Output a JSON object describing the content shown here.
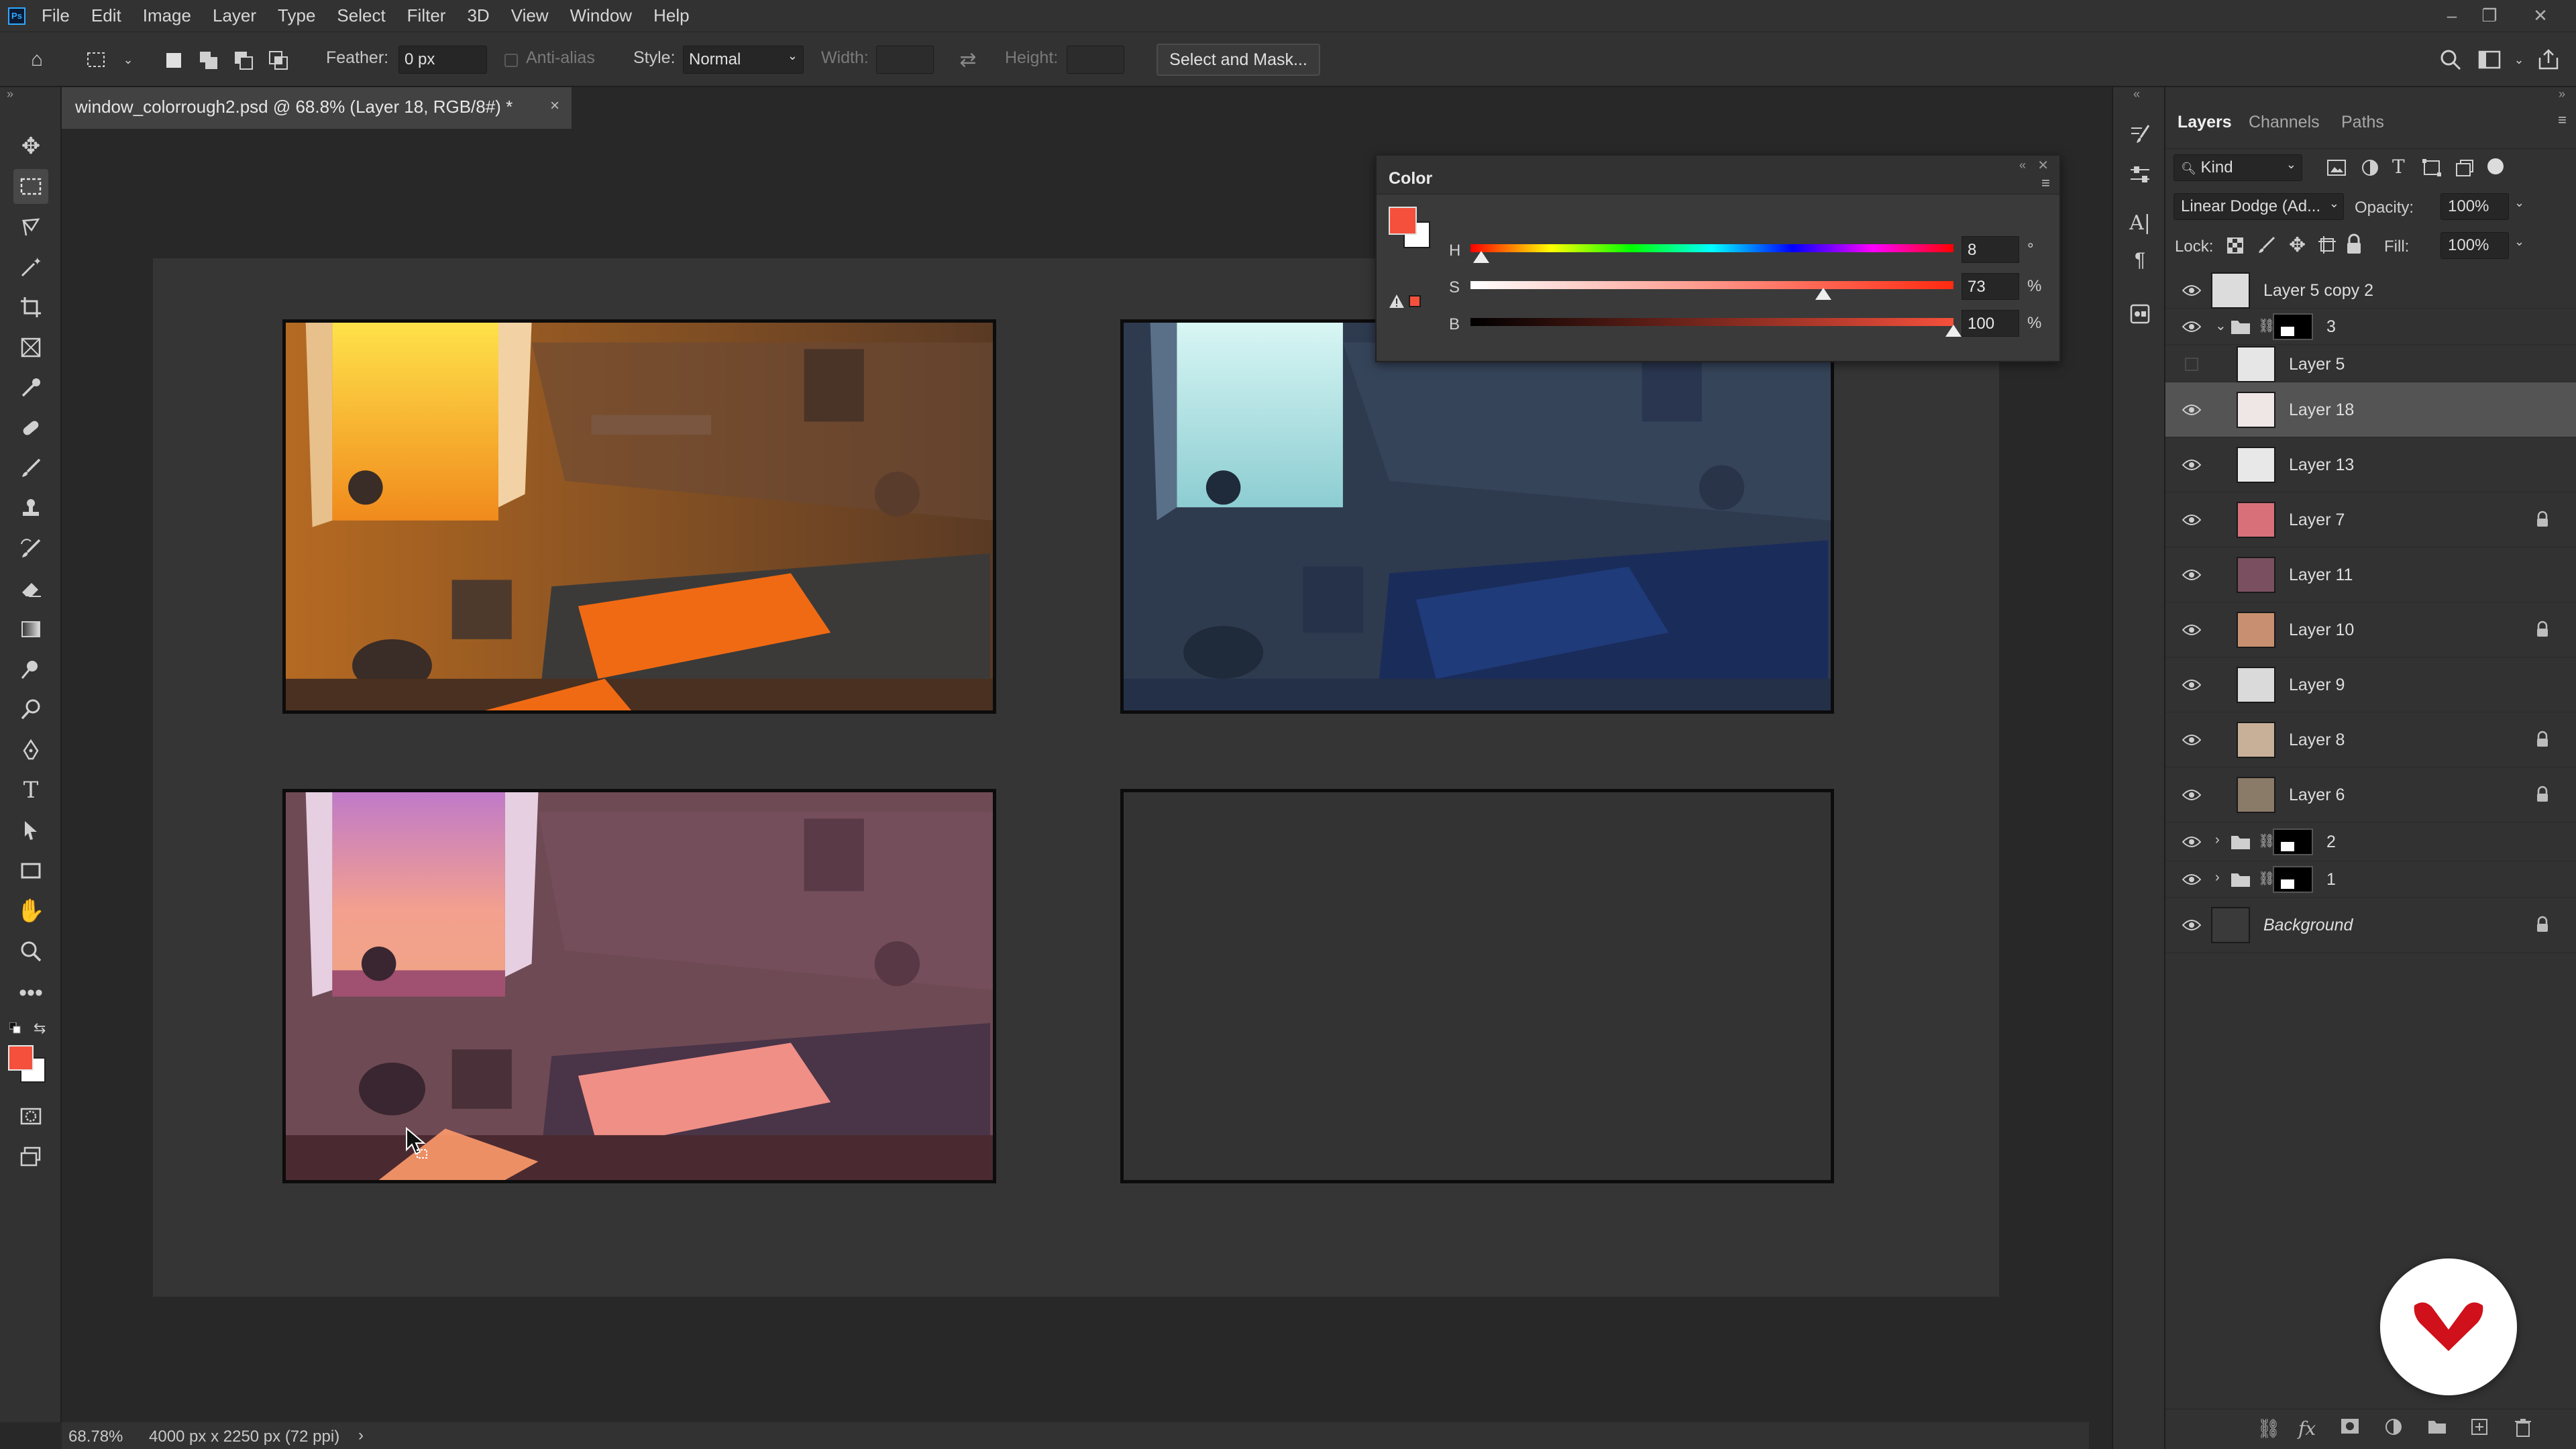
{
  "app": {
    "menu": [
      "File",
      "Edit",
      "Image",
      "Layer",
      "Type",
      "Select",
      "Filter",
      "3D",
      "View",
      "Window",
      "Help"
    ],
    "logo_text": "Ps"
  },
  "options": {
    "feather_label": "Feather:",
    "feather_value": "0 px",
    "anti_alias_label": "Anti-alias",
    "style_label": "Style:",
    "style_value": "Normal",
    "width_label": "Width:",
    "height_label": "Height:",
    "select_mask_label": "Select and Mask..."
  },
  "document": {
    "tab_title": "window_colorrough2.psd @ 68.8% (Layer 18, RGB/8#) *",
    "close_glyph": "×"
  },
  "status": {
    "zoom": "68.78%",
    "doc_info": "4000 px x 2250 px (72 ppi)",
    "arrow": "›"
  },
  "color_panel": {
    "title": "Color",
    "foreground_color": "#f5503c",
    "sliders": [
      {
        "label": "H",
        "value": "8",
        "unit": "°",
        "fraction": 0.022
      },
      {
        "label": "S",
        "value": "73",
        "unit": "%",
        "fraction": 0.73
      },
      {
        "label": "B",
        "value": "100",
        "unit": "%",
        "fraction": 1.0
      }
    ]
  },
  "layers_panel": {
    "tabs": [
      "Layers",
      "Channels",
      "Paths"
    ],
    "kind_label": "Kind",
    "blend_mode": "Linear Dodge (Ad...",
    "opacity_label": "Opacity:",
    "opacity_value": "100%",
    "lock_label": "Lock:",
    "fill_label": "Fill:",
    "fill_value": "100%",
    "layers": [
      {
        "name": "Layer 5 copy 2",
        "visible": true,
        "locked": false,
        "type": "layer",
        "selected": false
      },
      {
        "name": "3",
        "visible": true,
        "locked": false,
        "type": "group-open",
        "selected": false
      },
      {
        "name": "Layer 5",
        "visible": false,
        "locked": false,
        "type": "layer",
        "selected": false
      },
      {
        "name": "Layer 18",
        "visible": true,
        "locked": false,
        "type": "layer",
        "selected": true
      },
      {
        "name": "Layer 13",
        "visible": true,
        "locked": false,
        "type": "layer",
        "selected": false
      },
      {
        "name": "Layer 7",
        "visible": true,
        "locked": true,
        "type": "layer",
        "selected": false
      },
      {
        "name": "Layer 11",
        "visible": true,
        "locked": false,
        "type": "layer",
        "selected": false
      },
      {
        "name": "Layer 10",
        "visible": true,
        "locked": true,
        "type": "layer",
        "selected": false
      },
      {
        "name": "Layer 9",
        "visible": true,
        "locked": false,
        "type": "layer",
        "selected": false
      },
      {
        "name": "Layer 8",
        "visible": true,
        "locked": true,
        "type": "layer",
        "selected": false
      },
      {
        "name": "Layer 6",
        "visible": true,
        "locked": true,
        "type": "layer",
        "selected": false
      },
      {
        "name": "2",
        "visible": true,
        "locked": false,
        "type": "group-closed",
        "selected": false
      },
      {
        "name": "1",
        "visible": true,
        "locked": false,
        "type": "group-closed",
        "selected": false
      },
      {
        "name": "Background",
        "visible": true,
        "locked": true,
        "type": "background",
        "selected": false
      }
    ]
  },
  "colors": {
    "ui_dark": "#282828",
    "ui_panel": "#323232",
    "foreground": "#f5503c",
    "background_swatch": "#ffffff",
    "badge_red": "#d0101a"
  }
}
